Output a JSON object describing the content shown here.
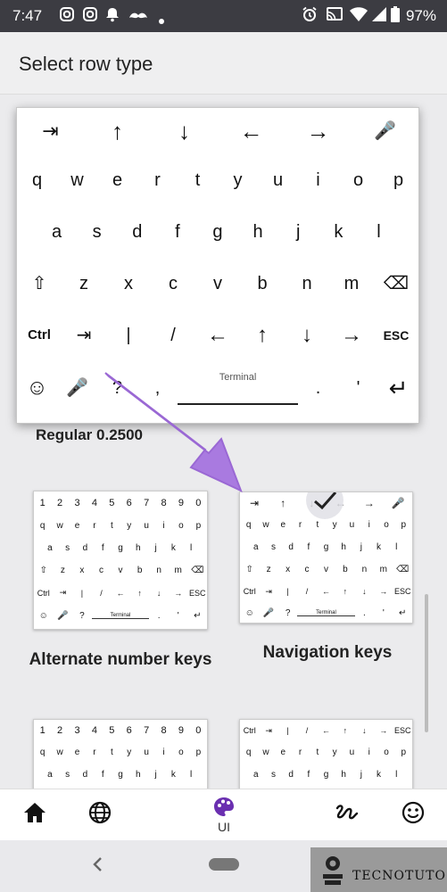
{
  "status": {
    "time": "7:47",
    "battery": "97%"
  },
  "title": "Select row type",
  "big_keyboard": {
    "row0": [
      "⇥",
      "↑",
      "↓",
      "←",
      "→",
      "🎤"
    ],
    "row1": [
      "q",
      "w",
      "e",
      "r",
      "t",
      "y",
      "u",
      "i",
      "o",
      "p"
    ],
    "row2": [
      "a",
      "s",
      "d",
      "f",
      "g",
      "h",
      "j",
      "k",
      "l"
    ],
    "row3": [
      "⇧",
      "z",
      "x",
      "c",
      "v",
      "b",
      "n",
      "m",
      "⌫"
    ],
    "row4": [
      "Ctrl",
      "⇥",
      "|",
      "/",
      "←",
      "↑",
      "↓",
      "→",
      "ESC"
    ],
    "row5_space": "Terminal",
    "row5_keys": [
      "☺",
      "🎤",
      "?",
      ",",
      ".",
      "'",
      "↵"
    ]
  },
  "hidden_caption": "Regular 0.2500",
  "options": [
    {
      "label": "Alternate number keys",
      "top": [
        "1",
        "2",
        "3",
        "4",
        "5",
        "6",
        "7",
        "8",
        "9",
        "0"
      ]
    },
    {
      "label": "Navigation keys",
      "top": [
        "⇥",
        "↑",
        "↓",
        "←",
        "→",
        "🎤"
      ]
    }
  ],
  "small_keys": {
    "r1": [
      "q",
      "w",
      "e",
      "r",
      "t",
      "y",
      "u",
      "i",
      "o",
      "p"
    ],
    "r2": [
      "a",
      "s",
      "d",
      "f",
      "g",
      "h",
      "j",
      "k",
      "l"
    ],
    "r3": [
      "⇧",
      "z",
      "x",
      "c",
      "v",
      "b",
      "n",
      "m",
      "⌫"
    ],
    "r4": [
      "Ctrl",
      "⇥",
      "|",
      "/",
      "←",
      "↑",
      "↓",
      "→",
      "ESC"
    ],
    "space": "Terminal",
    "r5": [
      "☺",
      "🎤",
      "?",
      ",",
      ".",
      "'",
      "↵"
    ]
  },
  "nav": {
    "active_label": "UI"
  },
  "watermark": "TECNOTUTO"
}
